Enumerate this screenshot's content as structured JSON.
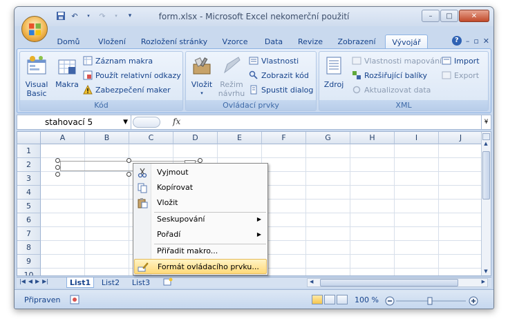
{
  "window": {
    "title": "form.xlsx - Microsoft Excel nekomerční použití"
  },
  "quick_access": {
    "icons": [
      "save-icon",
      "undo-icon",
      "redo-icon",
      "customize-icon"
    ]
  },
  "window_controls": {
    "minimize": "–",
    "maximize": "□",
    "close": "✕"
  },
  "ribbon_tabs": [
    {
      "label": "Domů"
    },
    {
      "label": "Vložení"
    },
    {
      "label": "Rozložení stránky"
    },
    {
      "label": "Vzorce"
    },
    {
      "label": "Data"
    },
    {
      "label": "Revize"
    },
    {
      "label": "Zobrazení"
    },
    {
      "label": "Vývojář"
    }
  ],
  "ribbon": {
    "code_group": {
      "label": "Kód",
      "visual_basic": "Visual Basic",
      "macros": "Makra",
      "record_macro": "Záznam makra",
      "relative_refs": "Použít relativní odkazy",
      "macro_security": "Zabezpečení maker"
    },
    "controls_group": {
      "label": "Ovládací prvky",
      "insert": "Vložit",
      "design_mode_1": "Režim",
      "design_mode_2": "návrhu",
      "properties": "Vlastnosti",
      "view_code": "Zobrazit kód",
      "run_dialog": "Spustit dialog"
    },
    "xml_group": {
      "label": "XML",
      "source": "Zdroj",
      "map_properties": "Vlastnosti mapování",
      "expansion_packs": "Rozšiřující balíky",
      "refresh_data": "Aktualizovat data",
      "import": "Import",
      "export": "Export"
    }
  },
  "formula_bar": {
    "name_box": "stahovací 5",
    "fx": "fx",
    "formula": ""
  },
  "sheet": {
    "columns": [
      "A",
      "B",
      "C",
      "D",
      "E",
      "F",
      "G",
      "H",
      "I",
      "J"
    ],
    "rows": [
      "1",
      "2",
      "3",
      "4",
      "5",
      "6",
      "7",
      "8",
      "9",
      "10"
    ]
  },
  "context_menu": {
    "items": [
      {
        "label": "Vyjmout",
        "icon": "scissors-icon"
      },
      {
        "label": "Kopírovat",
        "icon": "copy-icon"
      },
      {
        "label": "Vložit",
        "icon": "paste-icon"
      },
      {
        "label": "Seskupování",
        "submenu": true
      },
      {
        "label": "Pořadí",
        "submenu": true
      },
      {
        "label": "Přiřadit makro..."
      },
      {
        "label": "Formát ovládacího prvku...",
        "icon": "format-control-icon",
        "highlighted": true
      }
    ]
  },
  "sheet_tabs": [
    {
      "label": "List1",
      "active": true
    },
    {
      "label": "List2"
    },
    {
      "label": "List3"
    }
  ],
  "status_bar": {
    "status": "Připraven",
    "zoom": "100 %"
  },
  "colors": {
    "ribbon_text": "#15428b",
    "highlight": "#ffd979",
    "frame": "#c9d9ee"
  }
}
